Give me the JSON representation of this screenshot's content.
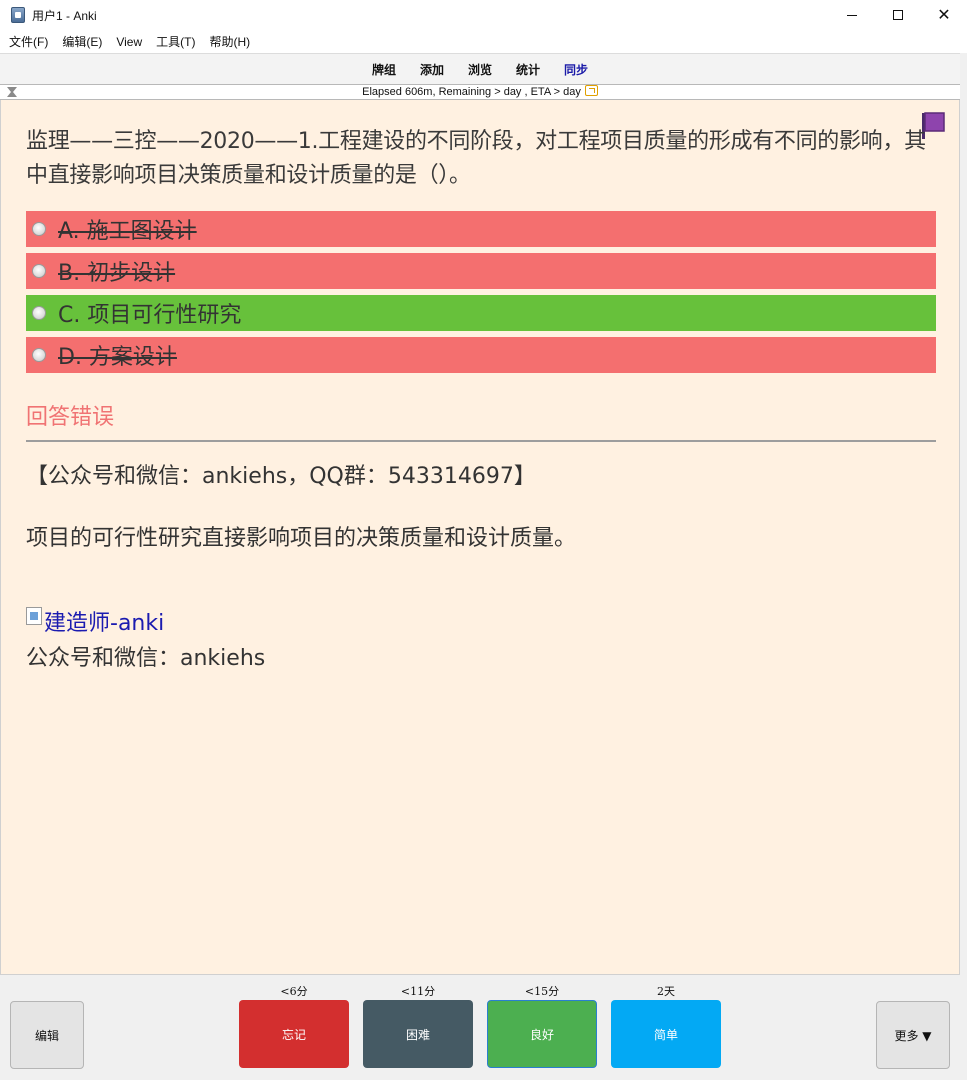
{
  "window": {
    "title": "用户1 - Anki"
  },
  "menu": [
    "文件(F)",
    "编辑(E)",
    "View",
    "工具(T)",
    "帮助(H)"
  ],
  "toolbar": {
    "decks": "牌组",
    "add": "添加",
    "browse": "浏览",
    "stats": "统计",
    "sync": "同步"
  },
  "status": {
    "text": "Elapsed 606m, Remaining > day , ETA > day"
  },
  "card": {
    "question": "监理——三控——2020——1.工程建设的不同阶段，对工程项目质量的形成有不同的影响，其中直接影响项目决策质量和设计质量的是（）。",
    "options": [
      {
        "label": "A. 施工图设计",
        "state": "wrong"
      },
      {
        "label": "B. 初步设计",
        "state": "wrong"
      },
      {
        "label": "C. 项目可行性研究",
        "state": "correct"
      },
      {
        "label": "D. 方案设计",
        "state": "wrong"
      }
    ],
    "result": "回答错误",
    "info": "【公众号和微信：ankiehs，QQ群：543314697】",
    "explanation": "项目的可行性研究直接影响项目的决策质量和设计质量。",
    "image_alt": "建造师-anki",
    "footer": "公众号和微信：ankiehs"
  },
  "bottom": {
    "edit": "编辑",
    "more": "更多 ▼",
    "again": {
      "label": "忘记",
      "time": "<6分"
    },
    "hard": {
      "label": "困难",
      "time": "<11分"
    },
    "good": {
      "label": "良好",
      "time": "<15分"
    },
    "easy": {
      "label": "简单",
      "time": "2天"
    }
  },
  "colors": {
    "card_bg": "#fff1e1",
    "wrong": "#f46f6f",
    "correct": "#67c13b",
    "again": "#d32f2f",
    "hard": "#455a64",
    "good": "#4caf50",
    "easy": "#03a9f4",
    "flag": "#8e44ad"
  }
}
